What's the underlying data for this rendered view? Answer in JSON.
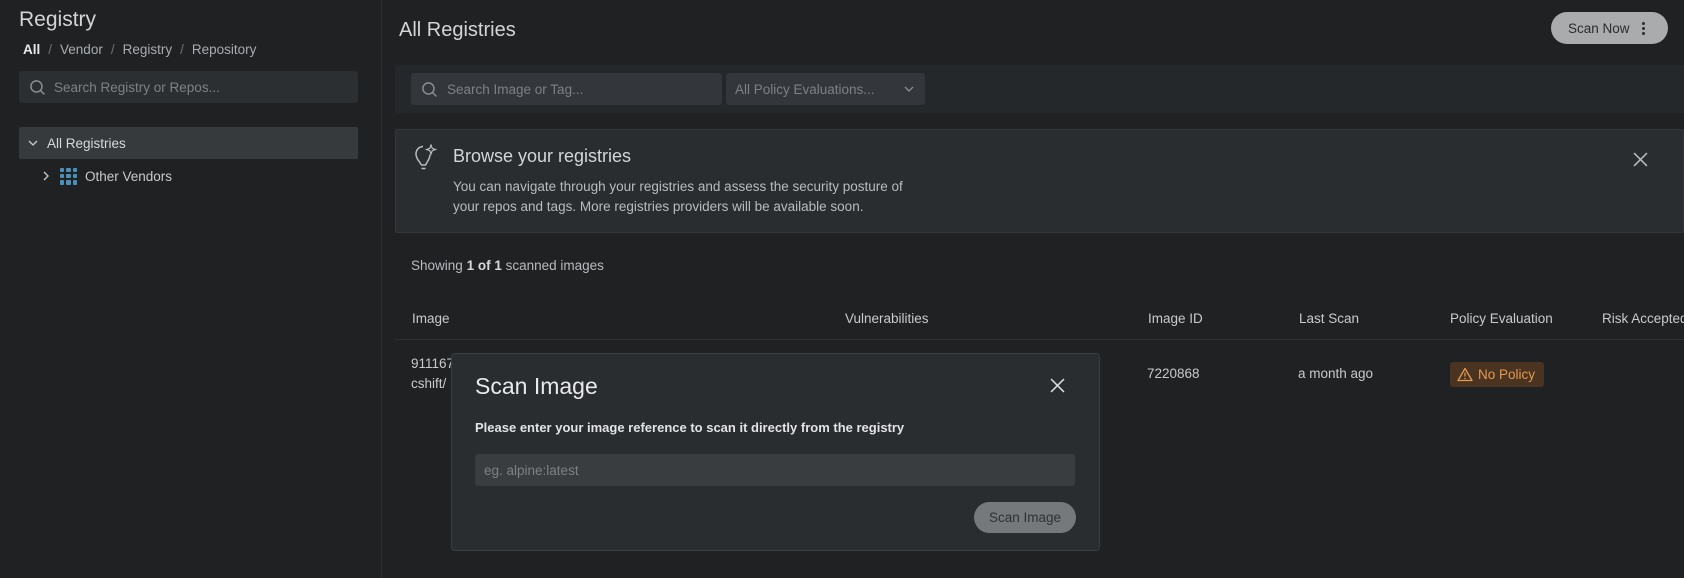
{
  "sidebar": {
    "title": "Registry",
    "breadcrumb": [
      "All",
      "Vendor",
      "Registry",
      "Repository"
    ],
    "search_placeholder": "Search Registry or Repos...",
    "tree": {
      "root_label": "All Registries",
      "children": [
        {
          "label": "Other Vendors",
          "icon": "grid-icon"
        }
      ]
    }
  },
  "main": {
    "title": "All Registries",
    "scan_now_label": "Scan Now",
    "search_placeholder": "Search Image or Tag...",
    "policy_filter": "All Policy Evaluations...",
    "banner": {
      "title": "Browse your registries",
      "text": "You can navigate through your registries and assess the security posture of your repos and tags. More registries providers will be available soon."
    },
    "showing": {
      "prefix": "Showing",
      "count": "1 of 1",
      "suffix": "scanned images"
    },
    "table": {
      "columns": [
        "Image",
        "Vulnerabilities",
        "Image ID",
        "Last Scan",
        "Policy Evaluation",
        "Risk Accepted"
      ],
      "rows": [
        {
          "image_line1": "911167",
          "image_line2": "cshift/",
          "image_id": "7220868",
          "last_scan": "a month ago",
          "policy": "No Policy"
        }
      ]
    }
  },
  "modal": {
    "title": "Scan Image",
    "description": "Please enter your image reference to scan it directly from the registry",
    "input_placeholder": "eg. alpine:latest",
    "button_label": "Scan Image"
  },
  "colors": {
    "background": "#1f2123",
    "warning": "#e39a4e",
    "vendor_icon": "#4c8fb8"
  }
}
